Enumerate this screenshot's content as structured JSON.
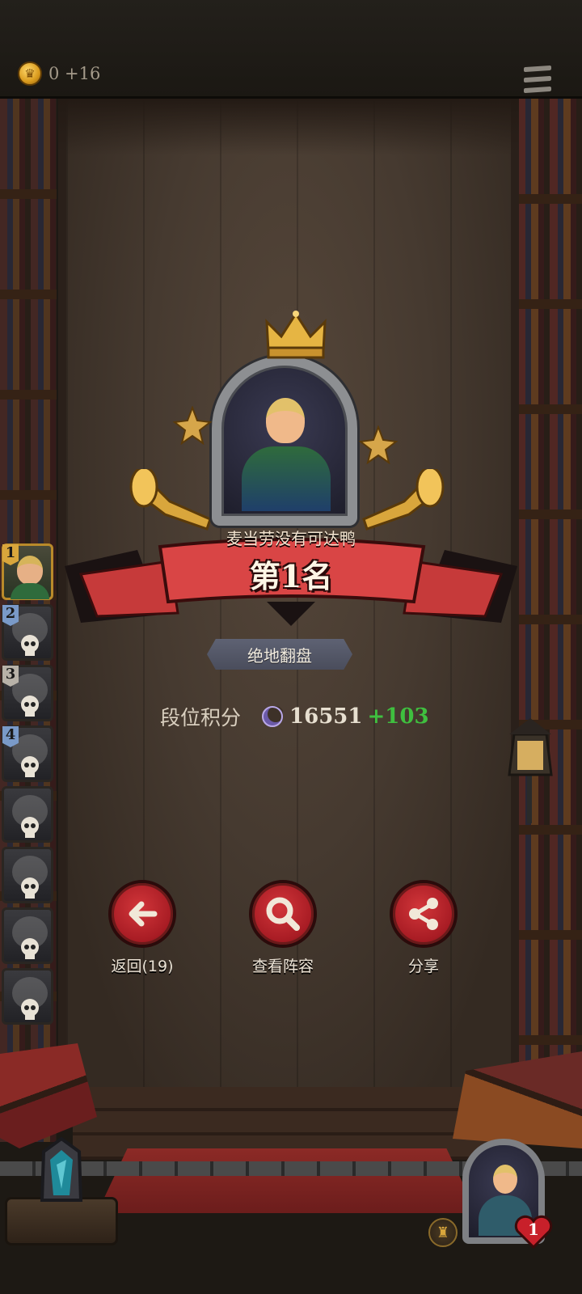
{
  "topbar": {
    "coins": "0 +16",
    "coin_icon": "crown-coin-icon",
    "menu_icon": "hamburger-menu-icon"
  },
  "result": {
    "player_name": "麦当劳没有可达鸭",
    "rank_title": "第1名",
    "achievement": "绝地翻盘",
    "score_label": "段位积分",
    "score_value": "16551",
    "score_delta": "+103"
  },
  "ranking_sidebar": [
    {
      "rank": "1",
      "badge": "gold",
      "eliminated": false
    },
    {
      "rank": "2",
      "badge": "blue",
      "eliminated": true
    },
    {
      "rank": "3",
      "badge": "silver",
      "eliminated": true
    },
    {
      "rank": "4",
      "badge": "blue",
      "eliminated": true
    },
    {
      "rank": "",
      "badge": "",
      "eliminated": true
    },
    {
      "rank": "",
      "badge": "",
      "eliminated": true
    },
    {
      "rank": "",
      "badge": "",
      "eliminated": true
    },
    {
      "rank": "",
      "badge": "",
      "eliminated": true
    }
  ],
  "actions": {
    "back_label": "返回(19)",
    "lineup_label": "查看阵容",
    "share_label": "分享"
  },
  "bottom": {
    "lives": "1"
  },
  "colors": {
    "ribbon_red": "#d94545",
    "action_red": "#b52028",
    "score_green": "#3fbf3f",
    "gold": "#d9a63c"
  }
}
